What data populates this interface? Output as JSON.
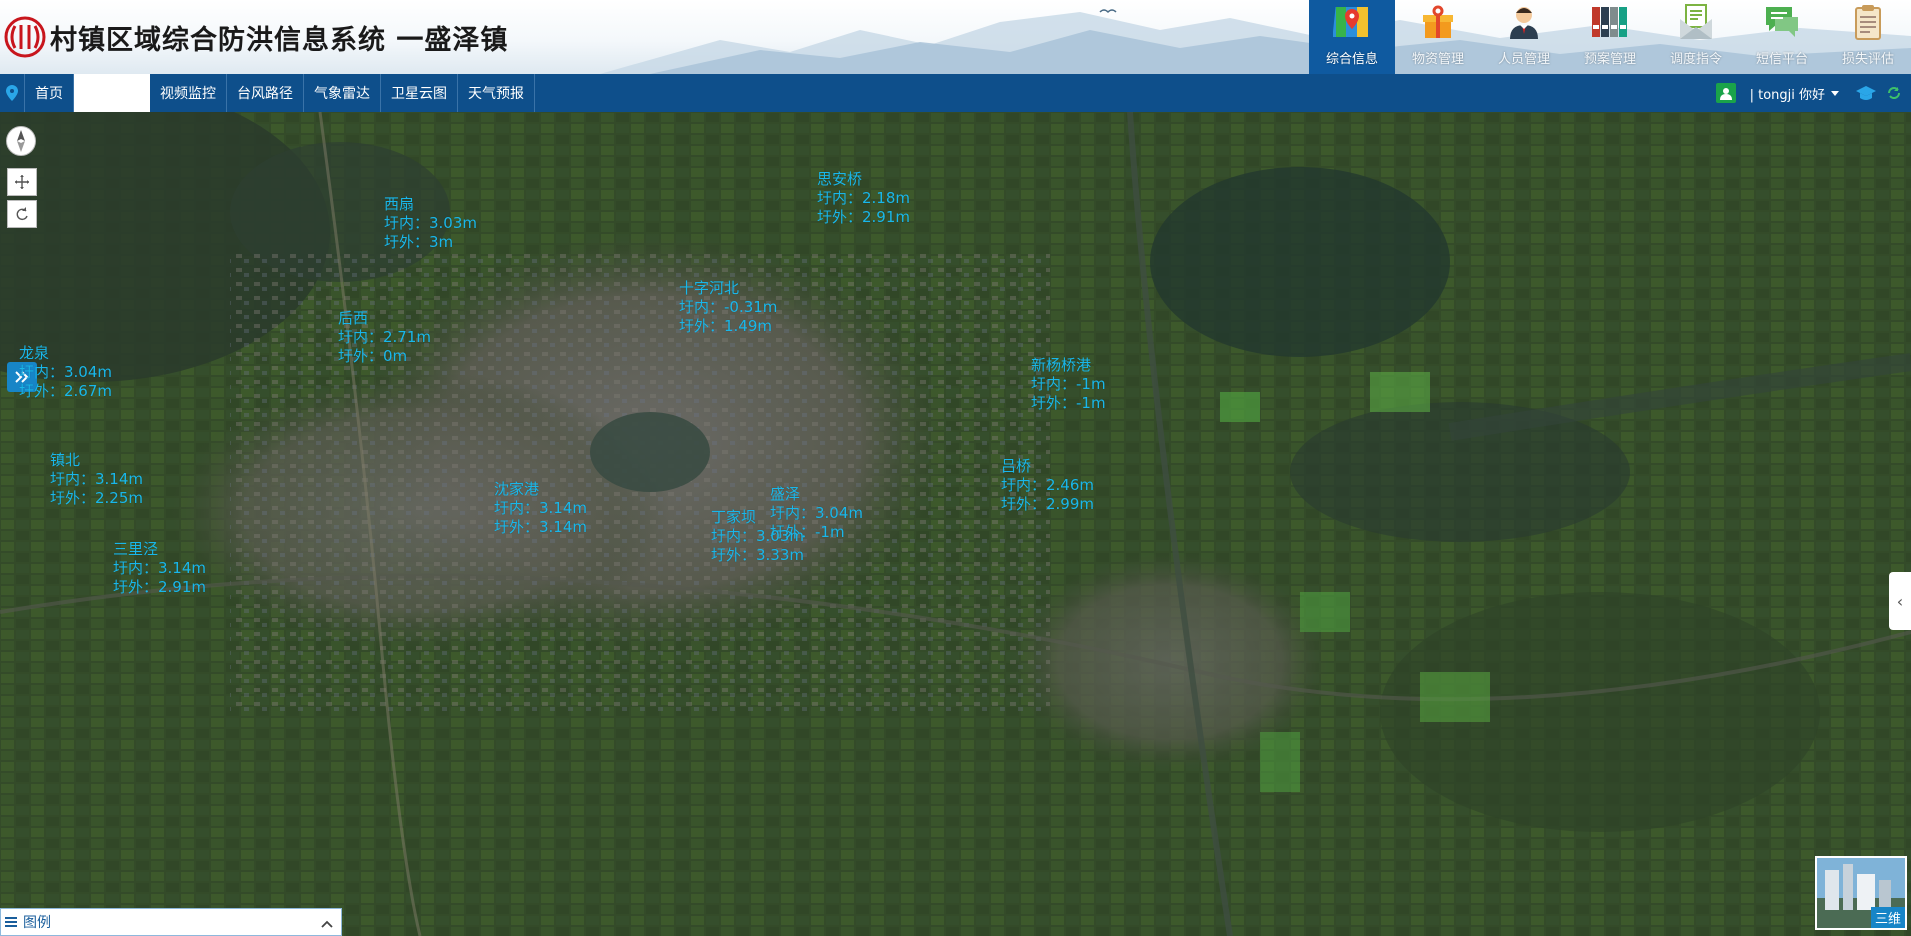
{
  "header": {
    "title": "村镇区域综合防洪信息系统 一盛泽镇",
    "modules": [
      {
        "label": "综合信息",
        "icon": "map-pin-icon",
        "active": true
      },
      {
        "label": "物资管理",
        "icon": "gift-box-icon",
        "active": false
      },
      {
        "label": "人员管理",
        "icon": "person-icon",
        "active": false
      },
      {
        "label": "预案管理",
        "icon": "binders-icon",
        "active": false
      },
      {
        "label": "调度指令",
        "icon": "envelope-icon",
        "active": false
      },
      {
        "label": "短信平台",
        "icon": "chat-icon",
        "active": false
      },
      {
        "label": "损失评估",
        "icon": "clipboard-icon",
        "active": false
      }
    ]
  },
  "nav": {
    "items": [
      "首页",
      "",
      "视频监控",
      "台风路径",
      "气象雷达",
      "卫星云图",
      "天气预报"
    ],
    "user": "| tongji  你好"
  },
  "stations": [
    {
      "name": "西扇",
      "inner": "圩内：3.03m",
      "outer": "圩外：3m"
    },
    {
      "name": "思安桥",
      "inner": "圩内：2.18m",
      "outer": "圩外：2.91m"
    },
    {
      "name": "十字河北",
      "inner": "圩内：-0.31m",
      "outer": "圩外：1.49m"
    },
    {
      "name": "后西",
      "inner": "圩内：2.71m",
      "outer": "圩外：0m"
    },
    {
      "name": "龙泉",
      "inner": "圩内：3.04m",
      "outer": "圩外：2.67m"
    },
    {
      "name": "新杨桥港",
      "inner": "圩内：-1m",
      "outer": "圩外：-1m"
    },
    {
      "name": "镇北",
      "inner": "圩内：3.14m",
      "outer": "圩外：2.25m"
    },
    {
      "name": "沈家港",
      "inner": "圩内：3.14m",
      "outer": "圩外：3.14m"
    },
    {
      "name": "盛泽",
      "inner": "圩内：3.04m",
      "outer": "圩外：-1m"
    },
    {
      "name": "丁家坝",
      "inner": "圩内：3.03m",
      "outer": "圩外：3.33m"
    },
    {
      "name": "吕桥",
      "inner": "圩内：2.46m",
      "outer": "圩外：2.99m"
    },
    {
      "name": "三里泾",
      "inner": "圩内：3.14m",
      "outer": "圩外：2.91m"
    }
  ],
  "legend": {
    "label": "图例"
  },
  "view3d": {
    "label": "三维"
  },
  "colors": {
    "navbar": "#0e4f8b",
    "active_module": "#0f5aa0",
    "station_text": "#19b7ea",
    "accent": "#1785c7"
  }
}
